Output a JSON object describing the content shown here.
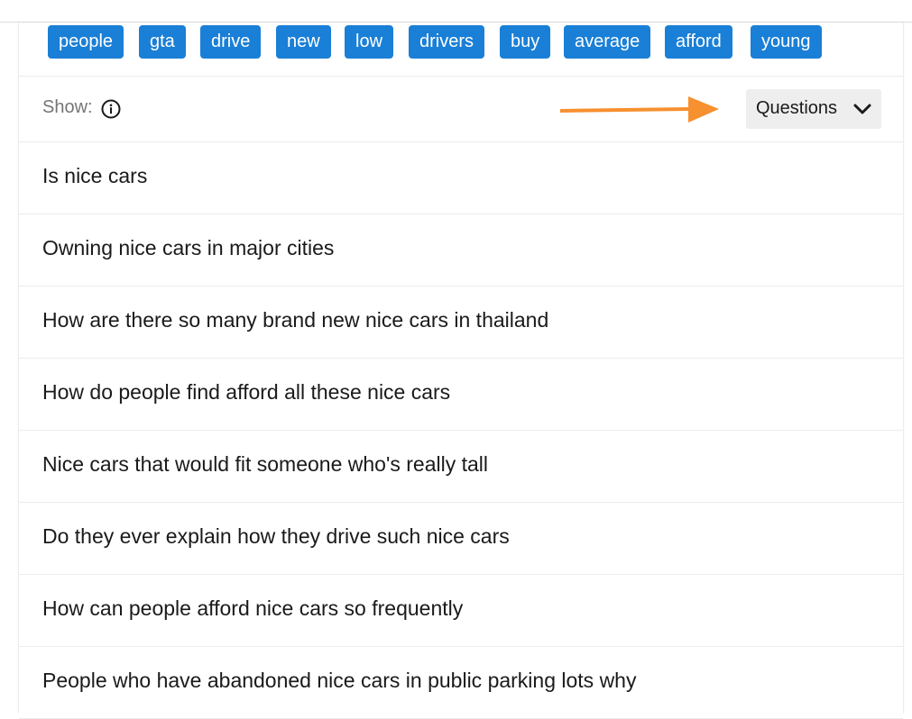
{
  "tags": [
    "people",
    "gta",
    "drive",
    "new",
    "low",
    "drivers",
    "buy",
    "average",
    "afford",
    "young"
  ],
  "show": {
    "label": "Show:",
    "dropdown_value": "Questions"
  },
  "questions": [
    "Is nice cars",
    "Owning nice cars in major cities",
    "How are there so many brand new nice cars in thailand",
    "How do people find afford all these nice cars",
    "Nice cars that would fit someone who's really tall",
    "Do they ever explain how they drive such nice cars",
    "How can people afford nice cars so frequently",
    "People who have abandoned nice cars in public parking lots why"
  ],
  "colors": {
    "tag_background": "#1a7fd6",
    "annotation_arrow": "#f7902f"
  },
  "icons": {
    "info": "info-icon",
    "chevron": "chevron-down-icon",
    "arrow": "arrow-right-icon"
  }
}
